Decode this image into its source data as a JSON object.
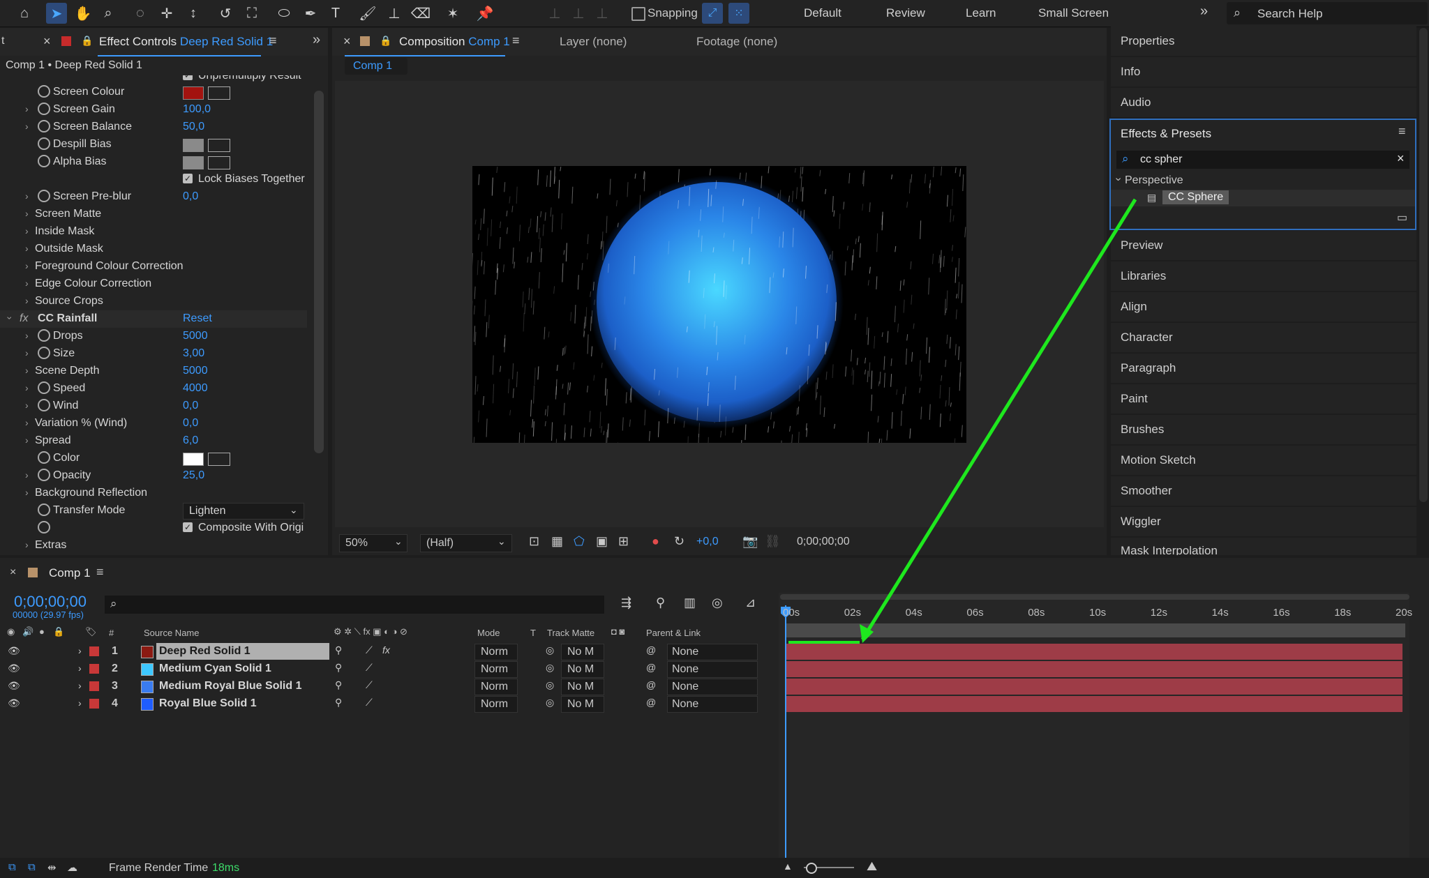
{
  "toolbar": {
    "snapping_label": "Snapping",
    "workspaces": [
      "Default",
      "Review",
      "Learn",
      "Small Screen"
    ],
    "search_placeholder": "Search Help"
  },
  "effect_controls": {
    "tab_prefix": "Effect Controls",
    "tab_layer": "Deep Red Solid 1",
    "left_stub": "t",
    "header": "Comp 1 • Deep Red Solid 1",
    "cut_text": "Unpremultiply Result",
    "rows": {
      "screen_colour": "Screen Colour",
      "screen_gain": "Screen Gain",
      "screen_gain_val": "100,0",
      "screen_balance": "Screen Balance",
      "screen_balance_val": "50,0",
      "despill_bias": "Despill Bias",
      "alpha_bias": "Alpha Bias",
      "lock_biases": "Lock Biases Together",
      "screen_preblur": "Screen Pre-blur",
      "screen_preblur_val": "0,0",
      "screen_matte": "Screen Matte",
      "inside_mask": "Inside Mask",
      "outside_mask": "Outside Mask",
      "fg_correction": "Foreground Colour Correction",
      "edge_correction": "Edge Colour Correction",
      "source_crops": "Source Crops",
      "cc_rainfall": "CC Rainfall",
      "reset": "Reset",
      "drops": "Drops",
      "drops_val": "5000",
      "size": "Size",
      "size_val": "3,00",
      "scene_depth": "Scene Depth",
      "scene_depth_val": "5000",
      "speed": "Speed",
      "speed_val": "4000",
      "wind": "Wind",
      "wind_val": "0,0",
      "variation": "Variation % (Wind)",
      "variation_val": "0,0",
      "spread": "Spread",
      "spread_val": "6,0",
      "color": "Color",
      "opacity": "Opacity",
      "opacity_val": "25,0",
      "bg_reflection": "Background Reflection",
      "transfer_mode": "Transfer Mode",
      "transfer_mode_val": "Lighten",
      "composite": "Composite With Origi",
      "extras": "Extras"
    },
    "colors": {
      "screen": "#a3130f",
      "despill": "#8a8a8a",
      "rain": "#ffffff"
    }
  },
  "composition": {
    "tab_prefix": "Composition",
    "tab_comp": "Comp 1",
    "layer_tab": "Layer (none)",
    "footage_tab": "Footage (none)",
    "sub_tab": "Comp 1",
    "zoom": "50%",
    "resolution": "(Half)",
    "exposure": "+0,0",
    "timecode": "0;00;00;00"
  },
  "right_panel": {
    "properties": "Properties",
    "info": "Info",
    "audio": "Audio",
    "effects_presets": "Effects & Presets",
    "search_value": "cc spher",
    "category": "Perspective",
    "result": "CC Sphere",
    "rest": [
      "Preview",
      "Libraries",
      "Align",
      "Character",
      "Paragraph",
      "Paint",
      "Brushes",
      "Motion Sketch",
      "Smoother",
      "Wiggler",
      "Mask Interpolation"
    ]
  },
  "timeline": {
    "tab": "Comp 1",
    "timecode": "0;00;00;00",
    "frames": "00000 (29.97 fps)",
    "columns": {
      "hash": "#",
      "source": "Source Name",
      "mode": "Mode",
      "t": "T",
      "track_matte": "Track Matte",
      "parent": "Parent & Link"
    },
    "layers": [
      {
        "num": "1",
        "name": "Deep Red Solid 1",
        "color": "#8b1a12",
        "mode": "Norm",
        "matte": "No M",
        "parent": "None"
      },
      {
        "num": "2",
        "name": "Medium Cyan Solid 1",
        "color": "#3ec8ff",
        "mode": "Norm",
        "matte": "No M",
        "parent": "None"
      },
      {
        "num": "3",
        "name": "Medium Royal Blue Solid 1",
        "color": "#3a7cf0",
        "mode": "Norm",
        "matte": "No M",
        "parent": "None"
      },
      {
        "num": "4",
        "name": "Royal Blue Solid 1",
        "color": "#1f5dff",
        "mode": "Norm",
        "matte": "No M",
        "parent": "None"
      }
    ],
    "ruler": [
      "00s",
      "02s",
      "04s",
      "06s",
      "08s",
      "10s",
      "12s",
      "14s",
      "16s",
      "18s",
      "20s"
    ],
    "render_label": "Frame Render Time",
    "render_value": "18ms"
  }
}
